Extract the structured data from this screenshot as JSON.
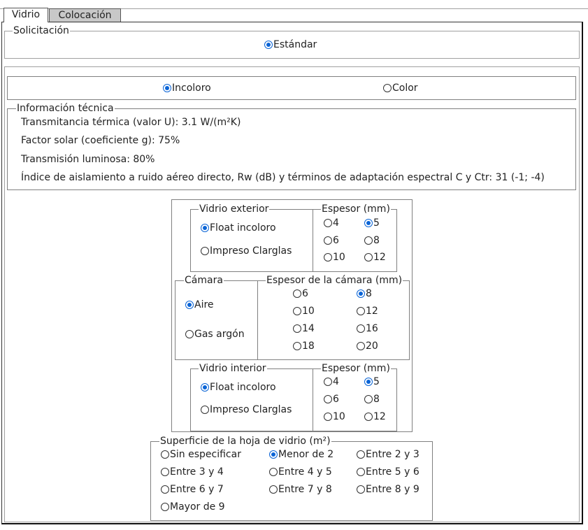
{
  "tabs": [
    {
      "label": "Vidrio",
      "active": true
    },
    {
      "label": "Colocación",
      "active": false
    }
  ],
  "solicitacion": {
    "legend": "Solicitación",
    "options": [
      {
        "label": "Estándar",
        "checked": true
      }
    ]
  },
  "color": {
    "options": [
      {
        "label": "Incoloro",
        "checked": true
      },
      {
        "label": "Color",
        "checked": false
      }
    ]
  },
  "info": {
    "legend": "Información técnica",
    "lines": [
      "Transmitancia térmica (valor U): 3.1 W/(m²K)",
      "Factor solar (coeficiente g): 75%",
      "Transmisión luminosa: 80%",
      "Índice de aislamiento a ruido aéreo directo, Rw (dB) y términos de adaptación espectral C y Ctr: 31 (-1; -4)"
    ]
  },
  "vidrio_exterior": {
    "legend": "Vidrio exterior",
    "options": [
      {
        "label": "Float incoloro",
        "checked": true
      },
      {
        "label": "Impreso Clarglas",
        "checked": false
      }
    ],
    "espesor_legend": "Espesor (mm)",
    "espesor": [
      {
        "label": "4",
        "checked": false
      },
      {
        "label": "5",
        "checked": true
      },
      {
        "label": "6",
        "checked": false
      },
      {
        "label": "8",
        "checked": false
      },
      {
        "label": "10",
        "checked": false
      },
      {
        "label": "12",
        "checked": false
      }
    ]
  },
  "camara": {
    "legend": "Cámara",
    "options": [
      {
        "label": "Aire",
        "checked": true
      },
      {
        "label": "Gas argón",
        "checked": false
      }
    ],
    "espesor_legend": "Espesor de la cámara (mm)",
    "espesor": [
      {
        "label": "6",
        "checked": false
      },
      {
        "label": "8",
        "checked": true
      },
      {
        "label": "10",
        "checked": false
      },
      {
        "label": "12",
        "checked": false
      },
      {
        "label": "14",
        "checked": false
      },
      {
        "label": "16",
        "checked": false
      },
      {
        "label": "18",
        "checked": false
      },
      {
        "label": "20",
        "checked": false
      }
    ]
  },
  "vidrio_interior": {
    "legend": "Vidrio interior",
    "options": [
      {
        "label": "Float incoloro",
        "checked": true
      },
      {
        "label": "Impreso Clarglas",
        "checked": false
      }
    ],
    "espesor_legend": "Espesor (mm)",
    "espesor": [
      {
        "label": "4",
        "checked": false
      },
      {
        "label": "5",
        "checked": true
      },
      {
        "label": "6",
        "checked": false
      },
      {
        "label": "8",
        "checked": false
      },
      {
        "label": "10",
        "checked": false
      },
      {
        "label": "12",
        "checked": false
      }
    ]
  },
  "superficie": {
    "legend": "Superficie de la hoja de vidrio (m²)",
    "options": [
      {
        "label": "Sin especificar",
        "checked": false
      },
      {
        "label": "Menor de 2",
        "checked": true
      },
      {
        "label": "Entre 2 y 3",
        "checked": false
      },
      {
        "label": "Entre 3 y 4",
        "checked": false
      },
      {
        "label": "Entre 4 y 5",
        "checked": false
      },
      {
        "label": "Entre 5 y 6",
        "checked": false
      },
      {
        "label": "Entre 6 y 7",
        "checked": false
      },
      {
        "label": "Entre 7 y 8",
        "checked": false
      },
      {
        "label": "Entre 8 y 9",
        "checked": false
      },
      {
        "label": "Mayor de 9",
        "checked": false
      }
    ]
  },
  "colors": {
    "accent": "#0a64d6",
    "tab_inactive": "#c8c8c8",
    "border": "#a0a0a0"
  }
}
